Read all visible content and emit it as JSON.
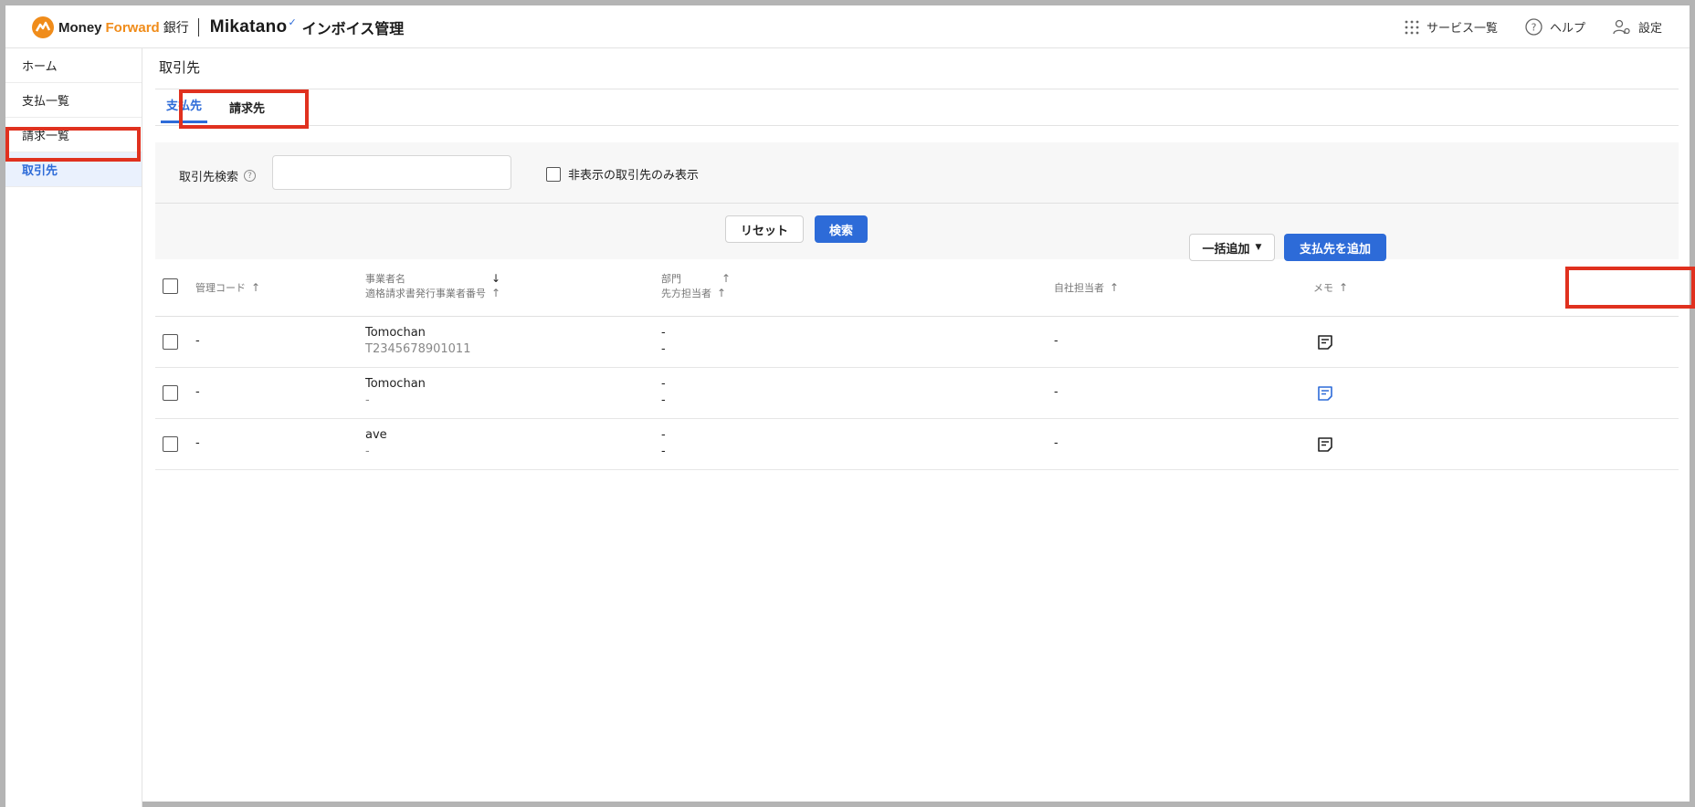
{
  "header": {
    "brand_money": "Money",
    "brand_forward": "Forward",
    "brand_bank": "銀行",
    "brand_mikatano": "Mikatano",
    "brand_product": "インボイス管理",
    "nav": [
      {
        "label": "サービス一覧",
        "icon": "grid-icon"
      },
      {
        "label": "ヘルプ",
        "icon": "help-circle-icon"
      },
      {
        "label": "設定",
        "icon": "user-settings-icon"
      }
    ]
  },
  "sidebar": {
    "items": [
      {
        "label": "ホーム",
        "active": false
      },
      {
        "label": "支払一覧",
        "active": false
      },
      {
        "label": "請求一覧",
        "active": false
      },
      {
        "label": "取引先",
        "active": true
      }
    ]
  },
  "page": {
    "title": "取引先",
    "tabs": [
      {
        "label": "支払先",
        "active": true
      },
      {
        "label": "請求先",
        "active": false
      }
    ]
  },
  "search": {
    "label": "取引先検索",
    "value": "",
    "placeholder": "",
    "hidden_only_label": "非表示の取引先のみ表示",
    "reset_label": "リセット",
    "search_label": "検索"
  },
  "actions": {
    "bulk_add_label": "一括追加",
    "add_label": "支払先を追加"
  },
  "table": {
    "headers": {
      "code": "管理コード",
      "name": "事業者名",
      "reg_no": "適格請求書発行事業者番号",
      "department": "部門",
      "contact": "先方担当者",
      "owner": "自社担当者",
      "memo": "メモ"
    },
    "rows": [
      {
        "code": "-",
        "name": "Tomochan",
        "reg_no": "T2345678901011",
        "department": "-",
        "contact": "-",
        "owner": "-",
        "memo_color": "#222222"
      },
      {
        "code": "-",
        "name": "Tomochan",
        "reg_no": "-",
        "department": "-",
        "contact": "-",
        "owner": "-",
        "memo_color": "#2d6bd8"
      },
      {
        "code": "-",
        "name": "ave",
        "reg_no": "-",
        "department": "-",
        "contact": "-",
        "owner": "-",
        "memo_color": "#222222"
      }
    ]
  },
  "colors": {
    "accent": "#2d6bd8",
    "brand_orange": "#f08c1a",
    "highlight": "#e0311f"
  }
}
